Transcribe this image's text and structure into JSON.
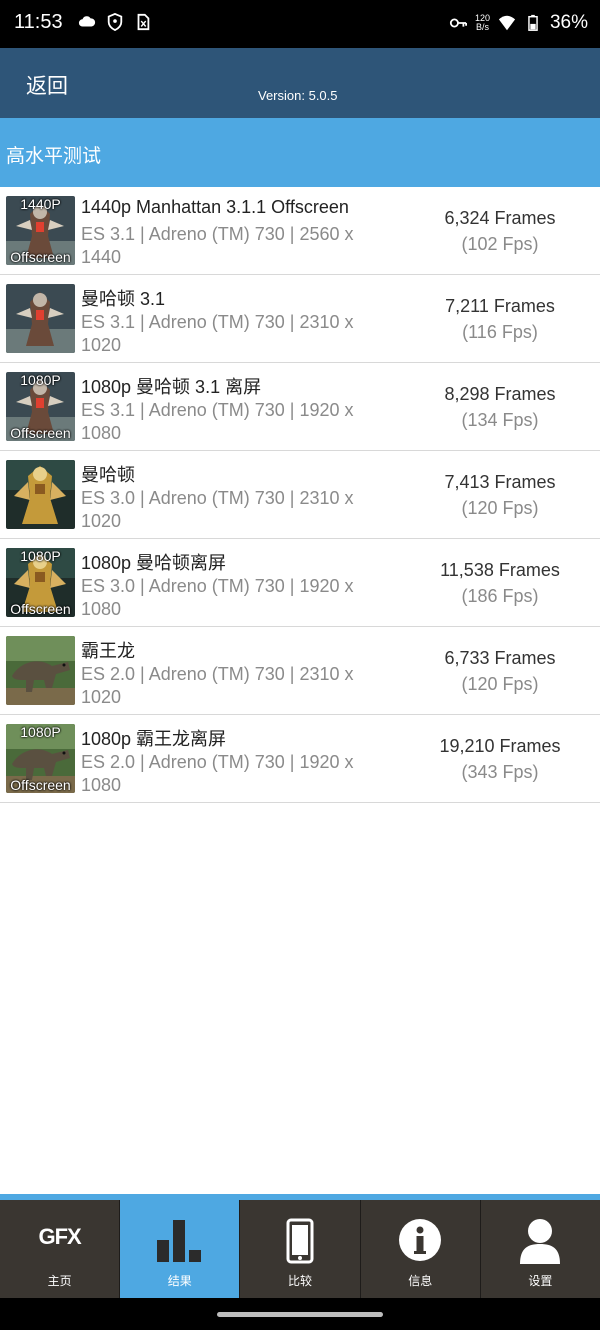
{
  "status_bar": {
    "time": "11:53",
    "net_speed_top": "120",
    "net_speed_bottom": "B/s",
    "battery": "36%"
  },
  "app_bar": {
    "back_label": "返回",
    "version": "Version: 5.0.5"
  },
  "section": {
    "title": "高水平测试"
  },
  "results": [
    {
      "title": "1440p Manhattan 3.1.1 Offscreen",
      "detail": "ES 3.1 | Adreno (TM) 730 | 2560 x 1440",
      "frames": "6,324 Frames",
      "fps": "(102 Fps)",
      "badge_top": "1440P",
      "badge_bottom": "Offscreen",
      "thumb": "robot"
    },
    {
      "title": "曼哈顿 3.1",
      "detail": "ES 3.1 | Adreno (TM) 730 | 2310 x 1020",
      "frames": "7,211 Frames",
      "fps": "(116 Fps)",
      "badge_top": "",
      "badge_bottom": "",
      "thumb": "robot"
    },
    {
      "title": "1080p 曼哈顿 3.1 离屏",
      "detail": "ES 3.1 | Adreno (TM) 730 | 1920 x 1080",
      "frames": "8,298 Frames",
      "fps": "(134 Fps)",
      "badge_top": "1080P",
      "badge_bottom": "Offscreen",
      "thumb": "robot"
    },
    {
      "title": "曼哈顿",
      "detail": "ES 3.0 | Adreno (TM) 730 | 2310 x 1020",
      "frames": "7,413 Frames",
      "fps": "(120 Fps)",
      "badge_top": "",
      "badge_bottom": "",
      "thumb": "mech"
    },
    {
      "title": "1080p 曼哈顿离屏",
      "detail": "ES 3.0 | Adreno (TM) 730 | 1920 x 1080",
      "frames": "11,538 Frames",
      "fps": "(186 Fps)",
      "badge_top": "1080P",
      "badge_bottom": "Offscreen",
      "thumb": "mech"
    },
    {
      "title": "霸王龙",
      "detail": "ES 2.0 | Adreno (TM) 730 | 2310 x 1020",
      "frames": "6,733 Frames",
      "fps": "(120 Fps)",
      "badge_top": "",
      "badge_bottom": "",
      "thumb": "trex"
    },
    {
      "title": "1080p 霸王龙离屏",
      "detail": "ES 2.0 | Adreno (TM) 730 | 1920 x 1080",
      "frames": "19,210 Frames",
      "fps": "(343 Fps)",
      "badge_top": "1080P",
      "badge_bottom": "Offscreen",
      "thumb": "trex"
    }
  ],
  "nav": {
    "home": {
      "label": "主页",
      "logo": "GFX",
      "icon": "gfx-logo-icon"
    },
    "results": {
      "label": "结果",
      "icon": "bar-chart-icon"
    },
    "compare": {
      "label": "比较",
      "icon": "phone-icon"
    },
    "info": {
      "label": "信息",
      "icon": "info-icon"
    },
    "settings": {
      "label": "设置",
      "icon": "user-icon"
    }
  },
  "colors": {
    "app_bar": "#2e5578",
    "accent": "#4ea8e2",
    "nav_bg": "#3a3631"
  }
}
